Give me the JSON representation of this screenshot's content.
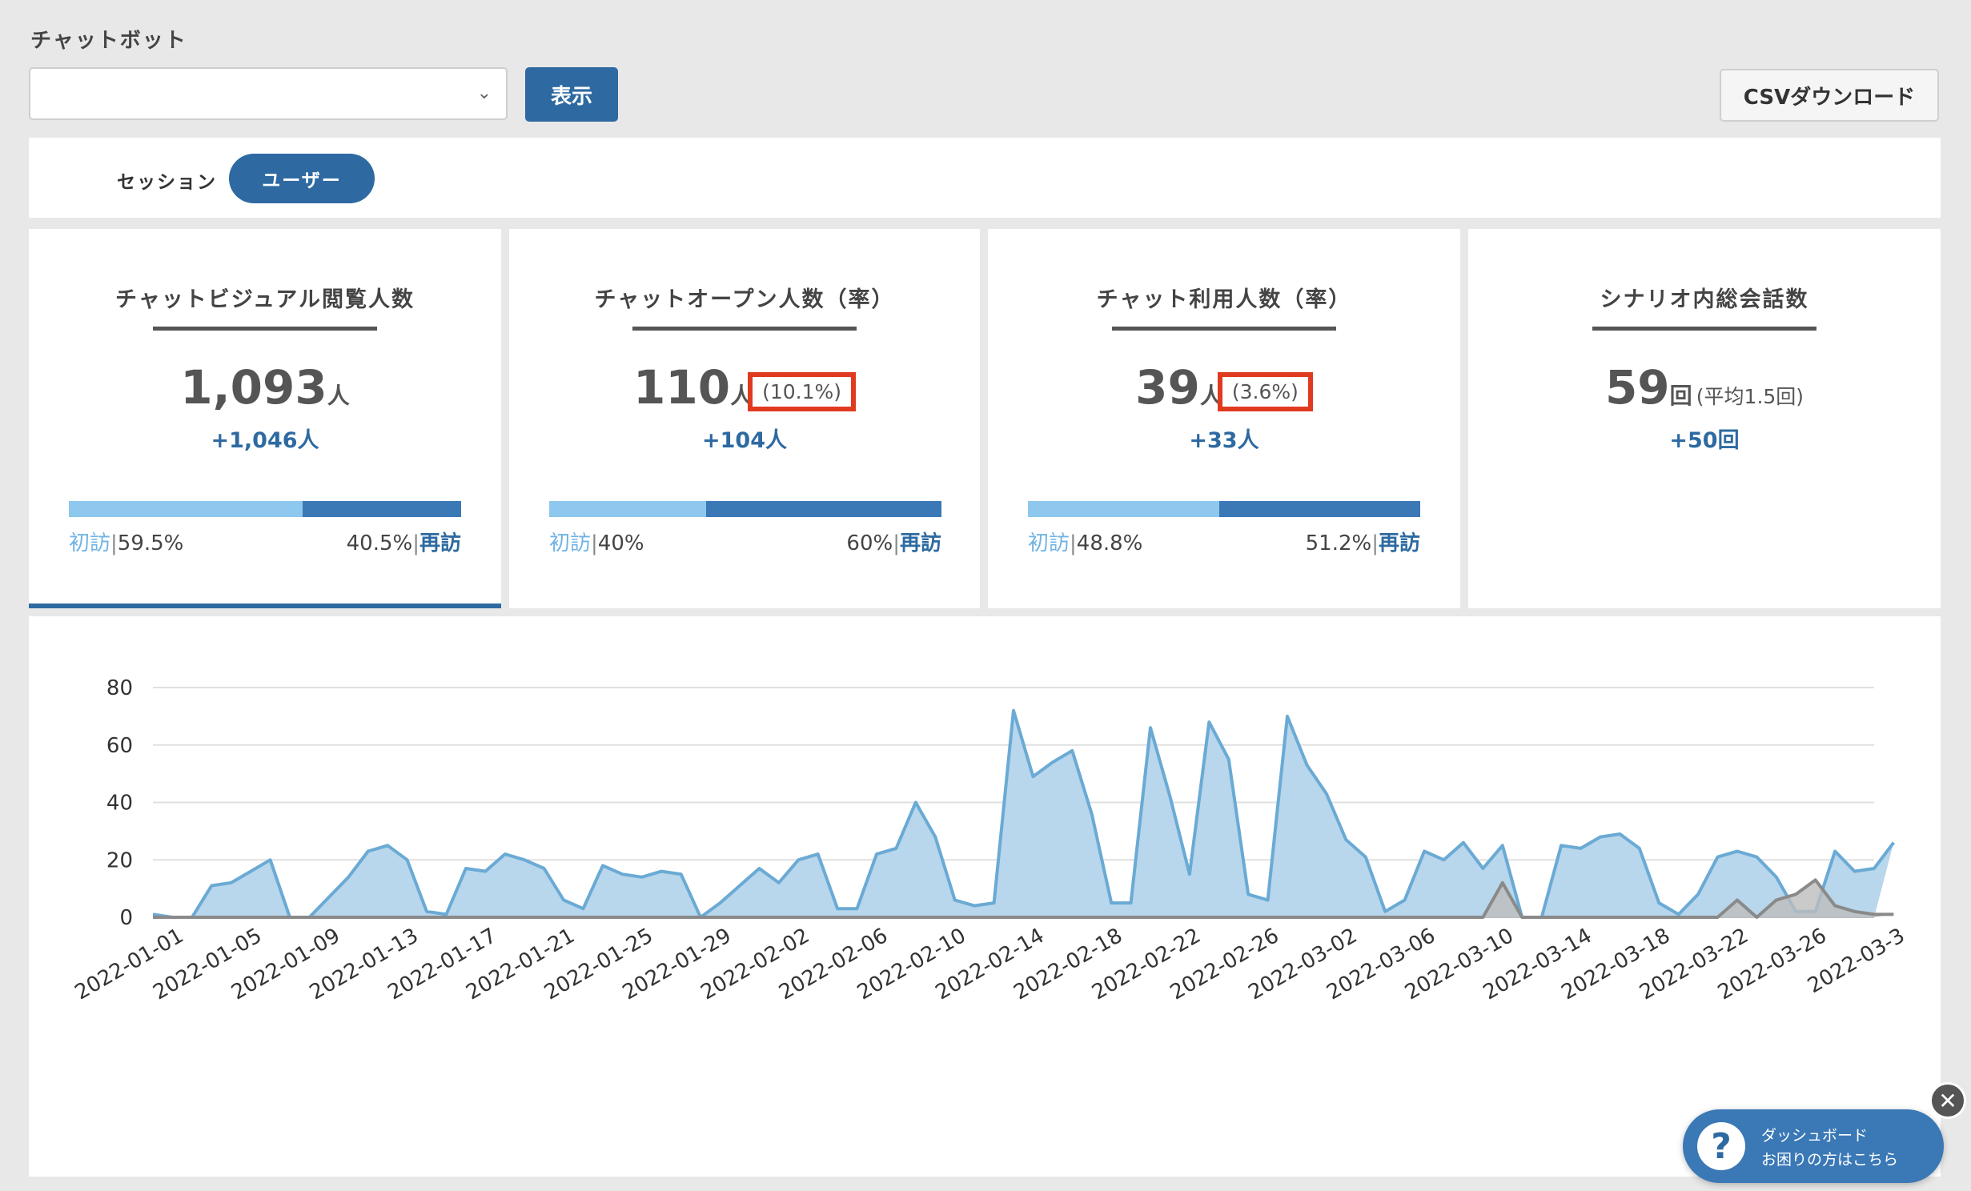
{
  "header": {
    "chatbot_label": "チャットボット",
    "select_value": "",
    "show_label": "表示",
    "csv_label": "CSVダウンロード"
  },
  "tabs": [
    {
      "label": "セッション",
      "active": false
    },
    {
      "label": "ユーザー",
      "active": true
    }
  ],
  "cards": [
    {
      "title": "チャットビジュアル閲覧人数",
      "value": "1,093",
      "unit": "人",
      "rate": "",
      "delta": "+1,046人",
      "first_label": "初訪",
      "first_pct": "59.5%",
      "first_fraction": 0.595,
      "repeat_label": "再訪",
      "repeat_pct": "40.5%",
      "active": true
    },
    {
      "title": "チャットオープン人数（率）",
      "value": "110",
      "unit": "人",
      "rate": "(10.1%)",
      "delta": "+104人",
      "first_label": "初訪",
      "first_pct": "40%",
      "first_fraction": 0.4,
      "repeat_label": "再訪",
      "repeat_pct": "60%",
      "active": false
    },
    {
      "title": "チャット利用人数（率）",
      "value": "39",
      "unit": "人",
      "rate": "(3.6%)",
      "delta": "+33人",
      "first_label": "初訪",
      "first_pct": "48.8%",
      "first_fraction": 0.488,
      "repeat_label": "再訪",
      "repeat_pct": "51.2%",
      "active": false
    },
    {
      "title": "シナリオ内総会話数",
      "value": "59",
      "unit": "回",
      "rate": "(平均1.5回)",
      "delta": "+50回",
      "active": false
    }
  ],
  "chart_data": {
    "type": "area",
    "x": [
      "2022-01-01",
      "2022-01-02",
      "2022-01-03",
      "2022-01-04",
      "2022-01-05",
      "2022-01-06",
      "2022-01-07",
      "2022-01-08",
      "2022-01-09",
      "2022-01-10",
      "2022-01-11",
      "2022-01-12",
      "2022-01-13",
      "2022-01-14",
      "2022-01-15",
      "2022-01-16",
      "2022-01-17",
      "2022-01-18",
      "2022-01-19",
      "2022-01-20",
      "2022-01-21",
      "2022-01-22",
      "2022-01-23",
      "2022-01-24",
      "2022-01-25",
      "2022-01-26",
      "2022-01-27",
      "2022-01-28",
      "2022-01-29",
      "2022-01-30",
      "2022-01-31",
      "2022-02-01",
      "2022-02-02",
      "2022-02-03",
      "2022-02-04",
      "2022-02-05",
      "2022-02-06",
      "2022-02-07",
      "2022-02-08",
      "2022-02-09",
      "2022-02-10",
      "2022-02-11",
      "2022-02-12",
      "2022-02-13",
      "2022-02-14",
      "2022-02-15",
      "2022-02-16",
      "2022-02-17",
      "2022-02-18",
      "2022-02-19",
      "2022-02-20",
      "2022-02-21",
      "2022-02-22",
      "2022-02-23",
      "2022-02-24",
      "2022-02-25",
      "2022-02-26",
      "2022-02-27",
      "2022-02-28",
      "2022-03-01",
      "2022-03-02",
      "2022-03-03",
      "2022-03-04",
      "2022-03-05",
      "2022-03-06",
      "2022-03-07",
      "2022-03-08",
      "2022-03-09",
      "2022-03-10",
      "2022-03-11",
      "2022-03-12",
      "2022-03-13",
      "2022-03-14",
      "2022-03-15",
      "2022-03-16",
      "2022-03-17",
      "2022-03-18",
      "2022-03-19",
      "2022-03-20",
      "2022-03-21",
      "2022-03-22",
      "2022-03-23",
      "2022-03-24",
      "2022-03-25",
      "2022-03-26",
      "2022-03-27",
      "2022-03-28",
      "2022-03-29",
      "2022-03-30"
    ],
    "tick_labels": [
      "2022-01-01",
      "2022-01-05",
      "2022-01-09",
      "2022-01-13",
      "2022-01-17",
      "2022-01-21",
      "2022-01-25",
      "2022-01-29",
      "2022-02-02",
      "2022-02-06",
      "2022-02-10",
      "2022-02-14",
      "2022-02-18",
      "2022-02-22",
      "2022-02-26",
      "2022-03-02",
      "2022-03-06",
      "2022-03-10",
      "2022-03-14",
      "2022-03-18",
      "2022-03-22",
      "2022-03-26",
      "2022-03-3"
    ],
    "series": [
      {
        "color": "#6aaad4",
        "fill": "#b8d6ec",
        "values": [
          1,
          0,
          0,
          11,
          12,
          16,
          20,
          0,
          0,
          7,
          14,
          23,
          25,
          20,
          2,
          1,
          17,
          16,
          22,
          20,
          17,
          6,
          3,
          18,
          15,
          14,
          16,
          15,
          0,
          5,
          11,
          17,
          12,
          20,
          22,
          3,
          3,
          22,
          24,
          40,
          28,
          6,
          4,
          5,
          72,
          49,
          54,
          58,
          36,
          5,
          5,
          66,
          42,
          15,
          68,
          55,
          8,
          6,
          70,
          53,
          43,
          27,
          21,
          2,
          6,
          23,
          20,
          26,
          17,
          25,
          0,
          0,
          25,
          24,
          28,
          29,
          24,
          5,
          1,
          8,
          21,
          23,
          21,
          14,
          2,
          2,
          23,
          16,
          17,
          26
        ]
      },
      {
        "color": "#8a8a8a",
        "fill": "#bdbdbd",
        "values": [
          0,
          0,
          0,
          0,
          0,
          0,
          0,
          0,
          0,
          0,
          0,
          0,
          0,
          0,
          0,
          0,
          0,
          0,
          0,
          0,
          0,
          0,
          0,
          0,
          0,
          0,
          0,
          0,
          0,
          0,
          0,
          0,
          0,
          0,
          0,
          0,
          0,
          0,
          0,
          0,
          0,
          0,
          0,
          0,
          0,
          0,
          0,
          0,
          0,
          0,
          0,
          0,
          0,
          0,
          0,
          0,
          0,
          0,
          0,
          0,
          0,
          0,
          0,
          0,
          0,
          0,
          0,
          0,
          0,
          12,
          0,
          0,
          0,
          0,
          0,
          0,
          0,
          0,
          0,
          0,
          0,
          6,
          0,
          6,
          8,
          13,
          4,
          2,
          1,
          1
        ]
      }
    ],
    "y_ticks": [
      "0",
      "20",
      "40",
      "60",
      "80"
    ],
    "ylim": [
      0,
      80
    ],
    "grid": true,
    "legend": false
  },
  "help": {
    "line1": "ダッシュボード",
    "line2": "お困りの方はこちら",
    "icon_glyph": "?",
    "close_glyph": "✕"
  }
}
